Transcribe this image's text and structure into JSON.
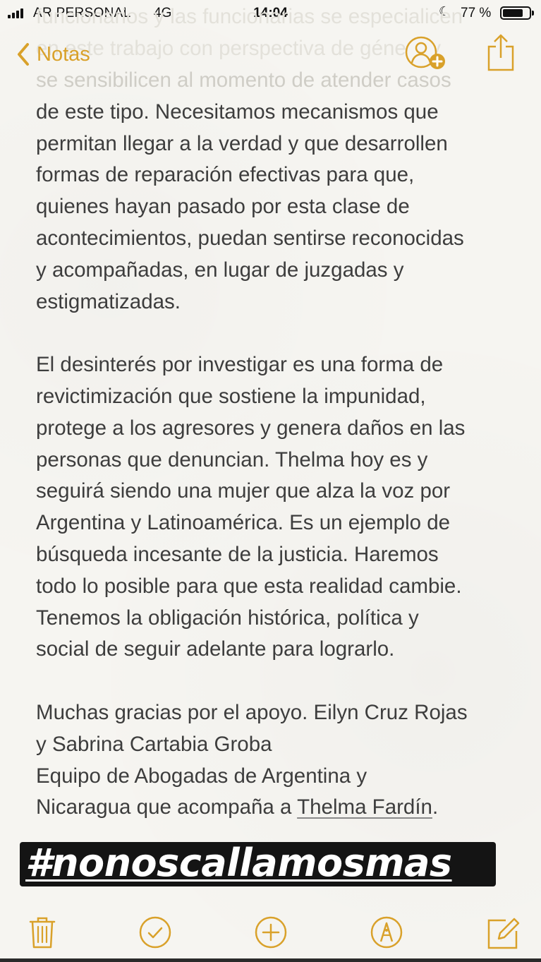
{
  "status_bar": {
    "carrier": "AR PERSONAL",
    "network": "4G",
    "time": "14:04",
    "battery_percent": "77 %",
    "battery_level": 0.77
  },
  "nav": {
    "back_label": "Notas"
  },
  "note": {
    "top_faded_lines": [
      "funcionarios y las funcionarias se especialicen",
      "en este trabajo con perspectiva de género y",
      "se sensibilicen al momento de atender casos"
    ],
    "paragraph_1": [
      "de este tipo. Necesitamos mecanismos que",
      "permitan llegar a la verdad y que desarrollen",
      "formas de reparación efectivas para que,",
      "quienes hayan pasado por esta clase de",
      "acontecimientos, puedan sentirse reconocidas",
      "y acompañadas, en lugar de juzgadas y",
      "estigmatizadas."
    ],
    "paragraph_2": [
      "El desinterés por investigar es una forma de",
      "revictimización que sostiene la impunidad,",
      "protege a los agresores y genera daños en las",
      "personas que denuncian. Thelma hoy es y",
      "seguirá siendo una mujer que alza la voz por",
      "Argentina y Latinoamérica. Es un ejemplo de",
      "búsqueda incesante de la justicia. Haremos",
      "todo lo posible para que esta realidad cambie.",
      "Tenemos la obligación histórica, política y",
      "social de seguir adelante para lograrlo."
    ],
    "paragraph_3": [
      "Muchas gracias por el apoyo. Eilyn Cruz Rojas",
      "y Sabrina Cartabia Groba",
      "Equipo de Abogadas de Argentina y"
    ],
    "last_line_prefix": "Nicaragua que acompaña a ",
    "last_line_link": "Thelma Fardín",
    "last_line_suffix": "."
  },
  "sticker": {
    "hashtag": "#nonoscallamosmas"
  },
  "icons": {
    "back": "chevron-left-icon",
    "add_person": "add-person-icon",
    "share": "share-icon",
    "trash": "trash-icon",
    "checklist": "checkmark-circle-icon",
    "add": "plus-circle-icon",
    "markup": "markup-pen-icon",
    "compose": "compose-icon"
  },
  "colors": {
    "accent": "#d9a12a",
    "text": "#3d3d3d",
    "paper": "#f6f5f1",
    "sticker_bg": "#141414",
    "sticker_text": "#ffffff"
  }
}
